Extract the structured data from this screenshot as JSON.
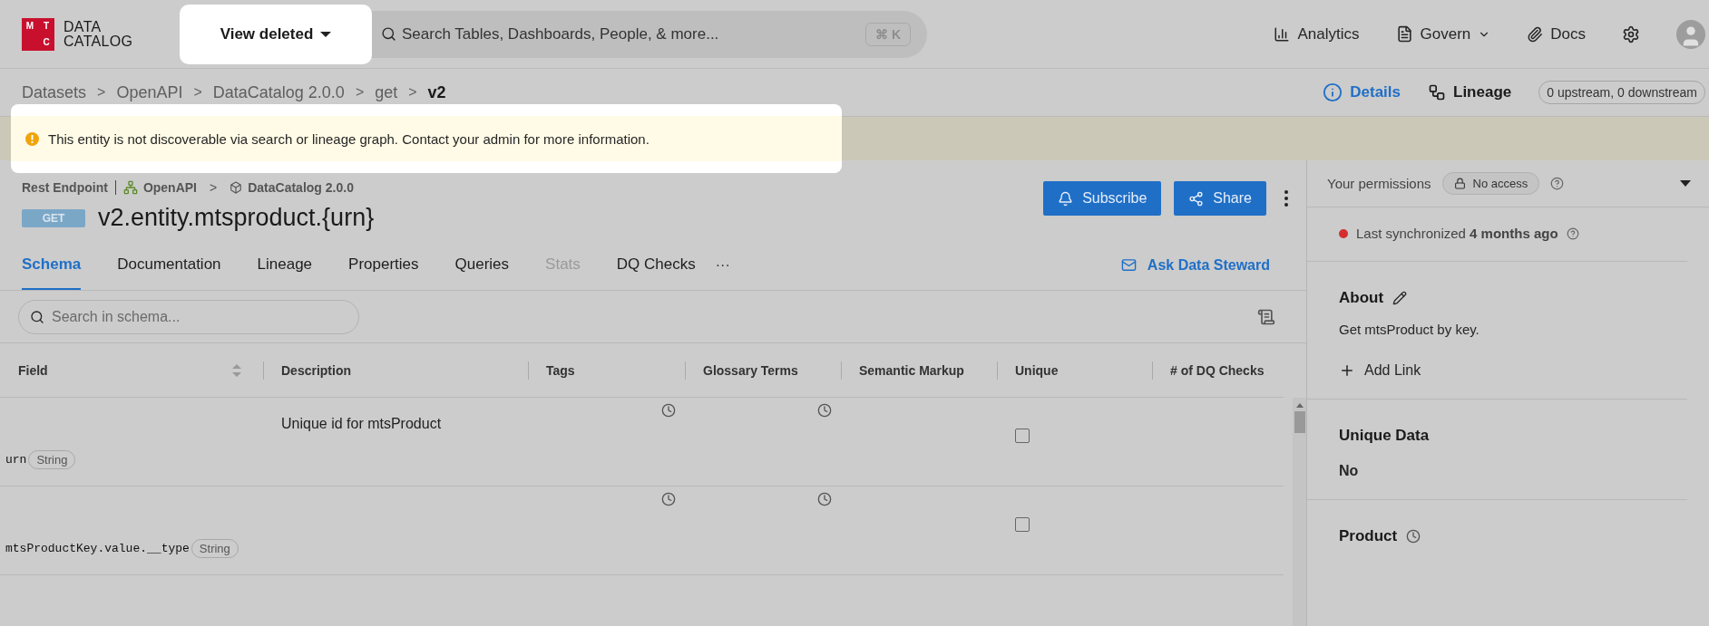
{
  "logo": {
    "mark_letters": [
      "M",
      "T",
      "C"
    ],
    "name_lines": [
      "DATA",
      "CATALOG"
    ]
  },
  "view_toggle": {
    "label": "View deleted"
  },
  "search": {
    "placeholder": "Search Tables, Dashboards, People, & more...",
    "shortcut": "⌘ K"
  },
  "nav": [
    {
      "kind": "analytics",
      "label": "Analytics",
      "dropdown": false
    },
    {
      "kind": "govern",
      "label": "Govern",
      "dropdown": true
    },
    {
      "kind": "docs",
      "label": "Docs",
      "dropdown": false
    }
  ],
  "breadcrumb": [
    {
      "label": "Datasets",
      "current": false
    },
    {
      "label": "OpenAPI",
      "current": false
    },
    {
      "label": "DataCatalog 2.0.0",
      "current": false
    },
    {
      "label": "get",
      "current": false
    },
    {
      "label": "v2",
      "current": true
    }
  ],
  "breadcrumb_separator": ">",
  "view_switch": [
    {
      "kind": "details",
      "label": "Details",
      "selected": true
    },
    {
      "kind": "lineage",
      "label": "Lineage",
      "selected": false
    }
  ],
  "lineage_count": "0 upstream, 0 downstream",
  "notice": "This entity is not discoverable via search or lineage graph. Contact your admin for more information.",
  "entity": {
    "type": "Rest Endpoint",
    "path": [
      {
        "kind": "service",
        "label": "OpenAPI"
      },
      {
        "kind": "collection",
        "label": "DataCatalog 2.0.0"
      }
    ],
    "path_separator": ">",
    "method": "GET",
    "title": "v2.entity.mtsproduct.{urn}"
  },
  "actions": [
    {
      "kind": "subscribe",
      "label": "Subscribe"
    },
    {
      "kind": "share",
      "label": "Share"
    }
  ],
  "tabs": [
    {
      "label": "Schema",
      "selected": true,
      "disabled": false
    },
    {
      "label": "Documentation",
      "selected": false,
      "disabled": false
    },
    {
      "label": "Lineage",
      "selected": false,
      "disabled": false
    },
    {
      "label": "Properties",
      "selected": false,
      "disabled": false
    },
    {
      "label": "Queries",
      "selected": false,
      "disabled": false
    },
    {
      "label": "Stats",
      "selected": false,
      "disabled": true
    },
    {
      "label": "DQ Checks",
      "selected": false,
      "disabled": false
    }
  ],
  "more_tabs": "···",
  "ask_steward": "Ask Data Steward",
  "schema_search": {
    "placeholder": "Search in schema..."
  },
  "table": {
    "columns": [
      {
        "label": "Field",
        "sortable": true
      },
      {
        "label": "Description",
        "sortable": false
      },
      {
        "label": "Tags",
        "sortable": false
      },
      {
        "label": "Glossary Terms",
        "sortable": false
      },
      {
        "label": "Semantic Markup",
        "sortable": false
      },
      {
        "label": "Unique",
        "sortable": false
      },
      {
        "label": "# of DQ Checks",
        "sortable": false
      }
    ],
    "rows": [
      {
        "field": "urn",
        "type": "String",
        "description": "Unique id for mtsProduct",
        "unique": false
      },
      {
        "field": "mtsProductKey.value.__type",
        "type": "String",
        "unique": false
      }
    ]
  },
  "sidebar": {
    "permissions_label": "Your permissions",
    "permission": "No access",
    "sync": {
      "text": "Last synchronized **4 months ago**",
      "color": "#d32f2f"
    },
    "about": {
      "heading": "About",
      "description": "Get mtsProduct by key.",
      "add_link": "Add Link"
    },
    "unique_data": {
      "heading": "Unique Data",
      "value": "No"
    },
    "product": {
      "heading": "Product"
    }
  }
}
